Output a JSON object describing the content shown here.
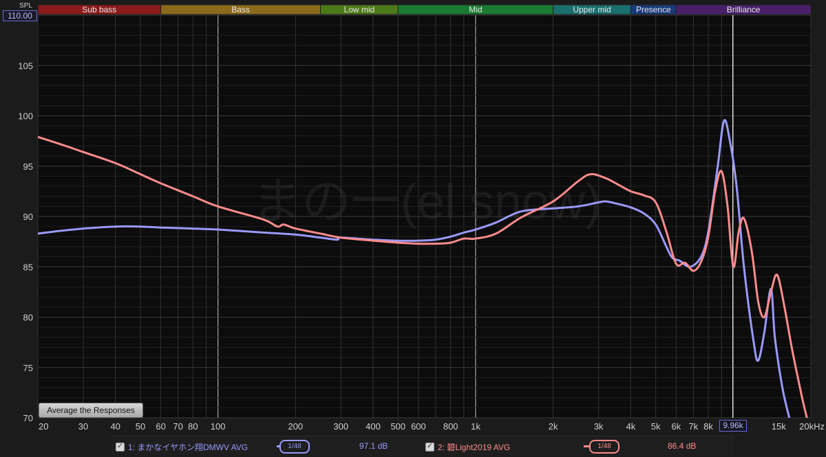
{
  "bands": [
    {
      "label": "Sub bass",
      "from": 20,
      "to": 60,
      "color": "#8b1a1a"
    },
    {
      "label": "Bass",
      "from": 60,
      "to": 250,
      "color": "#8b6a1a"
    },
    {
      "label": "Low mid",
      "from": 250,
      "to": 500,
      "color": "#4c7a18"
    },
    {
      "label": "Mid",
      "from": 500,
      "to": 2000,
      "color": "#1a7a32"
    },
    {
      "label": "Upper mid",
      "from": 2000,
      "to": 4000,
      "color": "#1a6e6e"
    },
    {
      "label": "Presence",
      "from": 4000,
      "to": 6000,
      "color": "#1a3a7a"
    },
    {
      "label": "Brilliance",
      "from": 6000,
      "to": 20000,
      "color": "#4a1f6a"
    }
  ],
  "ui": {
    "spl_label": "SPL",
    "y_top_value": "110.00",
    "x_marker_value": "9.96k",
    "average_button": "Average the Responses",
    "watermark": "まの一(el snow)"
  },
  "legend": [
    {
      "check_label": "1: まかなイヤホン翔DMWV AVG",
      "smoothing": "1/48",
      "value": "97.1 dB",
      "color": "#9a9aff"
    },
    {
      "check_label": "2: 碧Light2019 AVG",
      "smoothing": "1/48",
      "value": "86.4 dB",
      "color": "#ff8c8c"
    }
  ],
  "chart_data": {
    "type": "line",
    "title": "",
    "xlabel": "",
    "ylabel": "SPL",
    "x_scale": "log",
    "xlim": [
      20,
      20000
    ],
    "ylim": [
      70,
      110
    ],
    "grid": true,
    "y_ticks": [
      {
        "v": 70,
        "label": "70"
      },
      {
        "v": 75,
        "label": "75"
      },
      {
        "v": 80,
        "label": "80"
      },
      {
        "v": 85,
        "label": "85"
      },
      {
        "v": 90,
        "label": "90"
      },
      {
        "v": 95,
        "label": "95"
      },
      {
        "v": 100,
        "label": "100"
      },
      {
        "v": 105,
        "label": "105"
      }
    ],
    "x_ticks": [
      {
        "v": 20,
        "label": "20"
      },
      {
        "v": 30,
        "label": "30"
      },
      {
        "v": 40,
        "label": "40"
      },
      {
        "v": 50,
        "label": "50"
      },
      {
        "v": 60,
        "label": "60"
      },
      {
        "v": 70,
        "label": "70"
      },
      {
        "v": 80,
        "label": "80"
      },
      {
        "v": 100,
        "label": "100"
      },
      {
        "v": 200,
        "label": "200"
      },
      {
        "v": 300,
        "label": "300"
      },
      {
        "v": 400,
        "label": "400"
      },
      {
        "v": 500,
        "label": "500"
      },
      {
        "v": 600,
        "label": "600"
      },
      {
        "v": 800,
        "label": "800"
      },
      {
        "v": 1000,
        "label": "1k"
      },
      {
        "v": 2000,
        "label": "2k"
      },
      {
        "v": 3000,
        "label": "3k"
      },
      {
        "v": 4000,
        "label": "4k"
      },
      {
        "v": 5000,
        "label": "5k"
      },
      {
        "v": 6000,
        "label": "6k"
      },
      {
        "v": 7000,
        "label": "7k"
      },
      {
        "v": 8000,
        "label": "8k"
      },
      {
        "v": 15000,
        "label": "15k"
      },
      {
        "v": 20000,
        "label": "20kHz"
      }
    ],
    "major_lines": [
      100,
      1000
    ],
    "cursor_x": 9960,
    "series": [
      {
        "name": "1: まかなイヤホン翔DMWV AVG",
        "color": "#9a9aff",
        "points": [
          [
            20,
            88.3
          ],
          [
            25,
            88.6
          ],
          [
            30,
            88.8
          ],
          [
            40,
            89.0
          ],
          [
            50,
            89.0
          ],
          [
            60,
            88.9
          ],
          [
            80,
            88.8
          ],
          [
            100,
            88.7
          ],
          [
            150,
            88.4
          ],
          [
            200,
            88.2
          ],
          [
            250,
            87.9
          ],
          [
            290,
            87.7
          ],
          [
            300,
            87.9
          ],
          [
            400,
            87.7
          ],
          [
            500,
            87.6
          ],
          [
            600,
            87.6
          ],
          [
            700,
            87.7
          ],
          [
            800,
            88.0
          ],
          [
            900,
            88.4
          ],
          [
            1000,
            88.7
          ],
          [
            1200,
            89.4
          ],
          [
            1500,
            90.5
          ],
          [
            2000,
            90.8
          ],
          [
            2500,
            91.0
          ],
          [
            3000,
            91.4
          ],
          [
            3200,
            91.5
          ],
          [
            3500,
            91.3
          ],
          [
            4000,
            90.9
          ],
          [
            4500,
            90.3
          ],
          [
            5000,
            89.2
          ],
          [
            5500,
            87.0
          ],
          [
            5800,
            85.9
          ],
          [
            6200,
            85.6
          ],
          [
            6800,
            85.0
          ],
          [
            7500,
            86.0
          ],
          [
            8000,
            88.5
          ],
          [
            8700,
            95.0
          ],
          [
            9200,
            99.5
          ],
          [
            9700,
            97.5
          ],
          [
            10300,
            93.0
          ],
          [
            11000,
            85.0
          ],
          [
            12000,
            77.5
          ],
          [
            12500,
            75.7
          ],
          [
            13200,
            78.5
          ],
          [
            14000,
            82.8
          ],
          [
            14500,
            78.0
          ],
          [
            15500,
            73.0
          ],
          [
            16500,
            70.0
          ]
        ]
      },
      {
        "name": "2: 碧Light2019 AVG",
        "color": "#ff8c8c",
        "points": [
          [
            20,
            97.9
          ],
          [
            25,
            97.1
          ],
          [
            30,
            96.4
          ],
          [
            40,
            95.3
          ],
          [
            50,
            94.2
          ],
          [
            60,
            93.3
          ],
          [
            80,
            92.0
          ],
          [
            100,
            91.0
          ],
          [
            150,
            89.7
          ],
          [
            170,
            89.0
          ],
          [
            180,
            89.2
          ],
          [
            200,
            88.8
          ],
          [
            250,
            88.3
          ],
          [
            300,
            87.9
          ],
          [
            400,
            87.6
          ],
          [
            500,
            87.4
          ],
          [
            600,
            87.3
          ],
          [
            700,
            87.3
          ],
          [
            800,
            87.4
          ],
          [
            900,
            87.8
          ],
          [
            1000,
            87.8
          ],
          [
            1200,
            88.3
          ],
          [
            1500,
            89.9
          ],
          [
            2000,
            91.5
          ],
          [
            2500,
            93.5
          ],
          [
            2800,
            94.2
          ],
          [
            3200,
            93.8
          ],
          [
            3500,
            93.3
          ],
          [
            4000,
            92.5
          ],
          [
            4500,
            92.1
          ],
          [
            5000,
            91.4
          ],
          [
            5500,
            88.5
          ],
          [
            6000,
            85.3
          ],
          [
            6500,
            85.4
          ],
          [
            7000,
            84.6
          ],
          [
            7500,
            85.5
          ],
          [
            8000,
            88.0
          ],
          [
            8500,
            92.5
          ],
          [
            9000,
            94.5
          ],
          [
            9500,
            91.0
          ],
          [
            10000,
            85.0
          ],
          [
            10500,
            88.5
          ],
          [
            11000,
            89.8
          ],
          [
            11800,
            86.5
          ],
          [
            12500,
            81.5
          ],
          [
            13200,
            80.0
          ],
          [
            14000,
            82.5
          ],
          [
            14800,
            84.2
          ],
          [
            15800,
            81.0
          ],
          [
            17000,
            76.5
          ],
          [
            18500,
            72.0
          ],
          [
            19300,
            70.0
          ]
        ]
      }
    ]
  }
}
